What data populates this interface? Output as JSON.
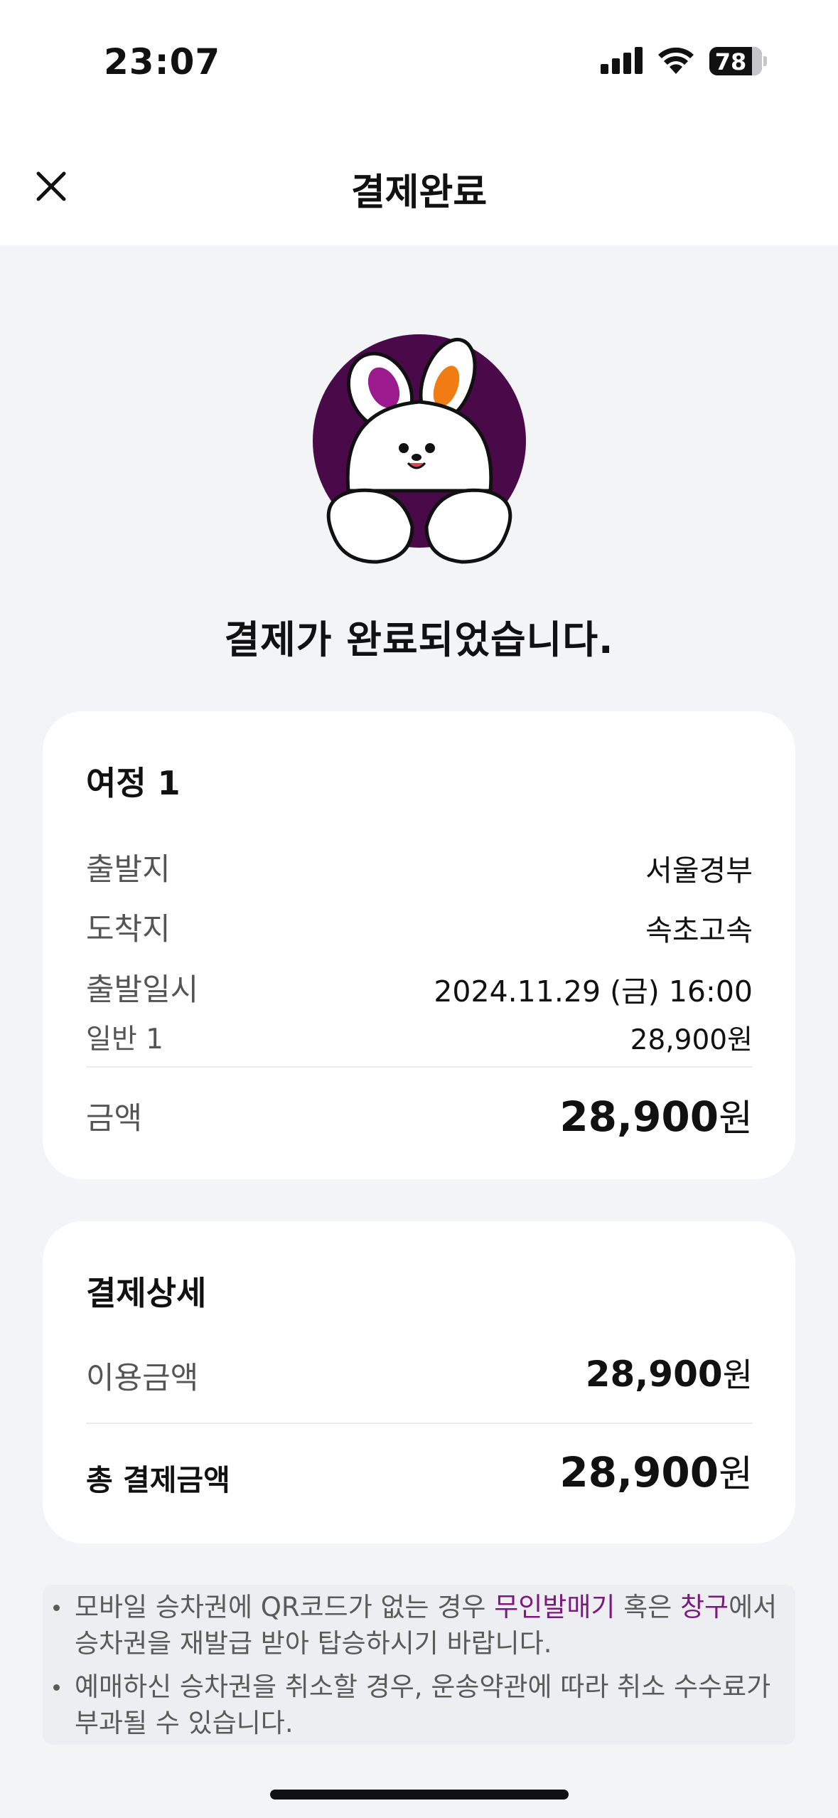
{
  "status_bar": {
    "time": "23:07",
    "battery": "78"
  },
  "nav": {
    "title": "결제완료",
    "close_icon": "close-icon"
  },
  "headline": "결제가 완료되었습니다.",
  "journey": {
    "title": "여정 1",
    "departure_label": "출발지",
    "departure_value": "서울경부",
    "arrival_label": "도착지",
    "arrival_value": "속초고속",
    "datetime_label": "출발일시",
    "datetime_value": "2024.11.29 (금) 16:00",
    "fare_label": "일반 1",
    "fare_value": "28,900원",
    "amount_label": "금액",
    "amount_number": "28,900",
    "amount_unit": "원"
  },
  "payment_detail": {
    "title": "결제상세",
    "usage_label": "이용금액",
    "usage_number": "28,900",
    "usage_unit": "원",
    "total_label": "총 결제금액",
    "total_number": "28,900",
    "total_unit": "원"
  },
  "notice": {
    "line1_a": "모바일 승차권에 QR코드가 없는 경우 ",
    "line1_hl1": "무인발매기",
    "line1_b": " 혹은 ",
    "line1_hl2": "창구",
    "line1_c": "에서",
    "line1_d": "승차권을 재발급 받아 탑승하시기 바랍니다.",
    "line2": "예매하신 승차권을 취소할 경우, 운송약관에 따라 취소 수수료가 부과될 수 있습니다."
  },
  "colors": {
    "accent": "#7a1a7a",
    "mascot_bg": "#4a0a4a",
    "ear_left": "#9b1b8f",
    "ear_right": "#f07c13"
  }
}
